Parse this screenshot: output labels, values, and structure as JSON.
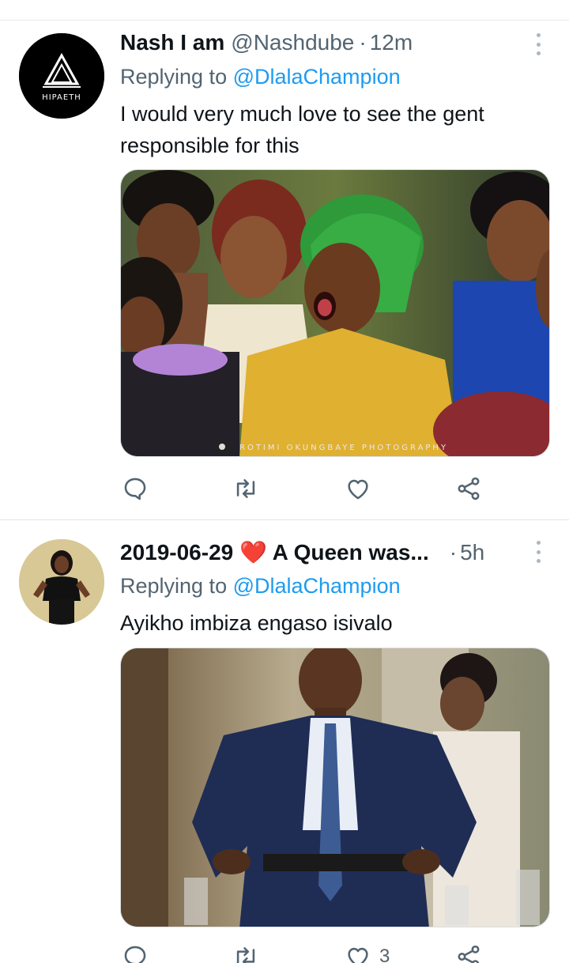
{
  "tweets": [
    {
      "name": "Nash I am",
      "handle": "@Nashdube",
      "separator": "·",
      "time": "12m",
      "replying_prefix": "Replying to ",
      "replying_to": "@DlalaChampion",
      "text": "I would very much love to see the gent responsible for this",
      "avatar_logo_text": "HIPAETH",
      "media_watermark": "ROTIMI OKUNGBAYE PHOTOGRAPHY",
      "counts": {
        "reply": "",
        "retweet": "",
        "like": ""
      }
    },
    {
      "name": "2019-06-29 ❤️ A Queen was...",
      "handle": "",
      "separator": "·",
      "time": "5h",
      "replying_prefix": "Replying to ",
      "replying_to": "@DlalaChampion",
      "text": "Ayikho imbiza engaso isivalo",
      "counts": {
        "reply": "",
        "retweet": "",
        "like": "3"
      }
    }
  ],
  "icons": {
    "reply": "reply-icon",
    "retweet": "retweet-icon",
    "like": "like-icon",
    "share": "share-icon",
    "more": "more-icon"
  },
  "colors": {
    "mention": "#1d9bf0",
    "secondary_text": "#536471",
    "primary_text": "#0f1419"
  }
}
